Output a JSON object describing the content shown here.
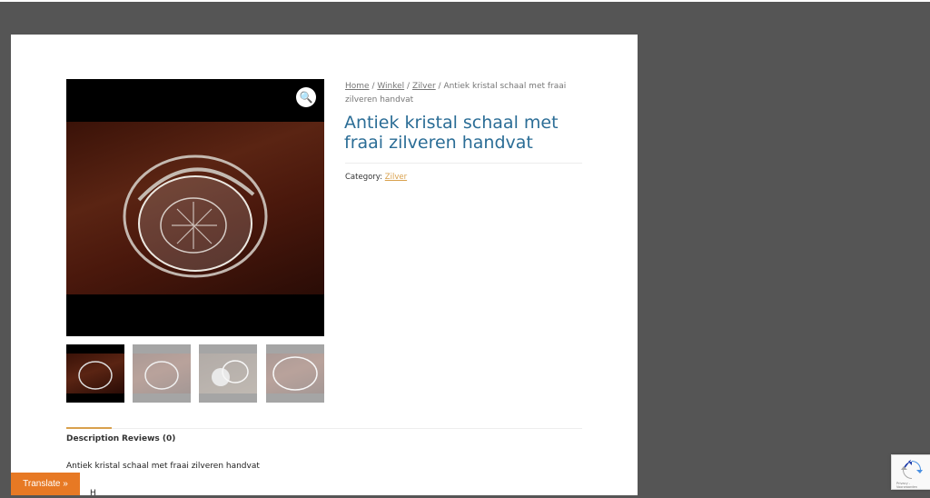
{
  "breadcrumb": {
    "home": "Home",
    "sep1": " / ",
    "shop": "Winkel",
    "sep2": " / ",
    "category": "Zilver",
    "current": " / Antiek kristal schaal met fraai zilveren handvat"
  },
  "product": {
    "title": "Antiek kristal schaal met fraai zilveren handvat",
    "category_label": "Category: ",
    "category_value": "Zilver"
  },
  "gallery": {
    "zoom_icon": "magnifier-icon",
    "thumbnails": [
      "thumb-1",
      "thumb-2",
      "thumb-3",
      "thumb-4"
    ]
  },
  "tabs": {
    "description": "Description",
    "reviews": "Reviews (0)"
  },
  "description_text": "Antiek kristal schaal met fraai zilveren handvat",
  "tail_text": "H",
  "translate_label": "Translate »",
  "recaptcha": {
    "footer": "Privacy - Voorwaarden"
  },
  "colors": {
    "title": "#2b6d96",
    "accent": "#d9a14d",
    "translate": "#e77924",
    "background": "#555555"
  }
}
